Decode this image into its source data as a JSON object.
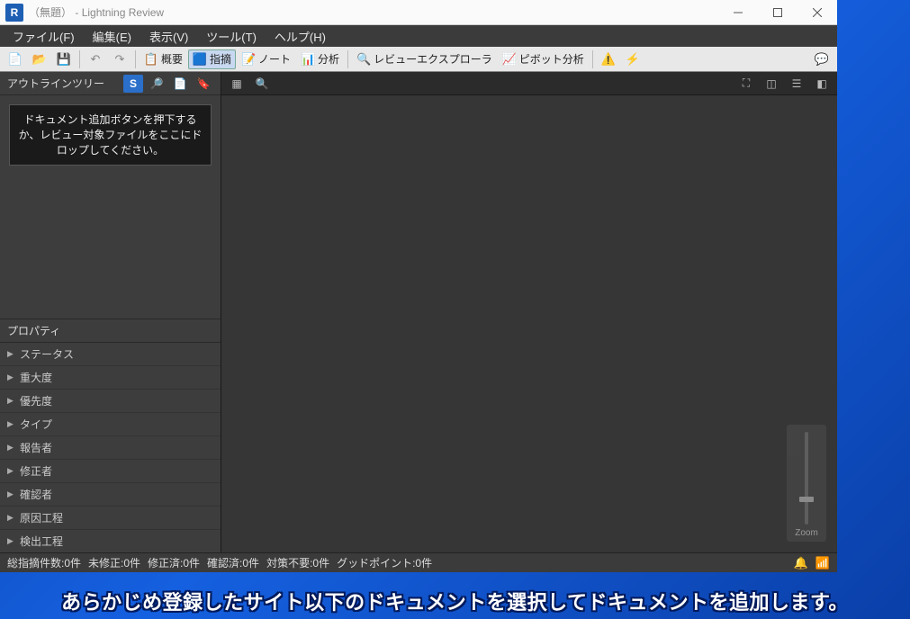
{
  "title": {
    "icon_letter": "R",
    "doc_name": "（無題）",
    "app_name": "- Lightning Review"
  },
  "menu": {
    "file": "ファイル(F)",
    "edit": "編集(E)",
    "view": "表示(V)",
    "tool": "ツール(T)",
    "help": "ヘルプ(H)"
  },
  "toolbar": {
    "overview": "概要",
    "point_out": "指摘",
    "note": "ノート",
    "analysis": "分析",
    "review_explorer": "レビューエクスプローラ",
    "pivot": "ピボット分析"
  },
  "sidebar": {
    "outline_title": "アウトラインツリー",
    "drop_hint": "ドキュメント追加ボタンを押下するか、レビュー対象ファイルをここにドロップしてください。",
    "property_title": "プロパティ",
    "props": [
      "ステータス",
      "重大度",
      "優先度",
      "タイプ",
      "報告者",
      "修正者",
      "確認者",
      "原因工程",
      "検出工程"
    ]
  },
  "zoom": {
    "label": "Zoom"
  },
  "status": {
    "total": "総指摘件数:0件",
    "unfixed": "未修正:0件",
    "fixed": "修正済:0件",
    "confirmed": "確認済:0件",
    "nofix": "対策不要:0件",
    "good": "グッドポイント:0件"
  },
  "subtitle": "あらかじめ登録したサイト以下のドキュメントを選択してドキュメントを追加します。"
}
